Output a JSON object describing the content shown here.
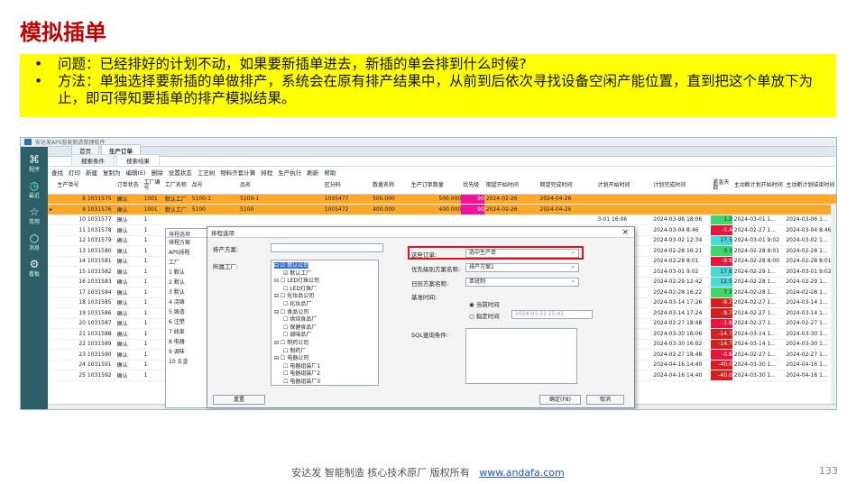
{
  "slide": {
    "title": "模拟插单",
    "bullets": [
      "问题：已经排好的计划不动，如果要新插单进去，新插的单会排到什么时候?",
      "方法：单独选择要新插的单做排产，系统会在原有排产结果中，从前到后依次寻找设备空闲产能位置，直到把这个单放下为止，即可得知要插单的排产模拟结果。"
    ],
    "bullet_symbol": "•",
    "footer_text": "安达发  智能制造 核心技术原厂  版权所有",
    "footer_link": "www.andafa.com",
    "page_number": "133"
  },
  "app": {
    "window_title": "安达发APS智能制造管理软件",
    "side": [
      {
        "icon": "⌘",
        "label": "程序"
      },
      {
        "icon": "◷",
        "label": "最近"
      },
      {
        "icon": "☆",
        "label": "常用"
      },
      {
        "icon": "○",
        "label": "消息"
      },
      {
        "icon": "⚙",
        "label": "看板"
      }
    ],
    "tabs": [
      "首页",
      "生产订单"
    ],
    "subtabs": [
      "搜索条件",
      "搜索结果"
    ],
    "toolbar": [
      "查找",
      "打印",
      "新建",
      "复制为",
      "编辑(E)",
      "删除",
      "设置状态",
      "工艺树",
      "物料齐套计算",
      "排程",
      "生产执行",
      "刷新",
      "帮助"
    ],
    "columns": [
      "生产单号",
      "订单状态",
      "工厂编号",
      "工厂名称",
      "品号",
      "品名",
      "区分码",
      "数量名称",
      "生产订单数量",
      "优先级",
      "期望开始时间",
      "期望完成时间",
      "计划开始时间",
      "计划完成时间",
      "紧急天数",
      "主动断计划开始时间",
      "主动断计划结束时间"
    ],
    "rows": [
      {
        "no": "8",
        "id": "1031575",
        "st": "确认",
        "f": "1001",
        "fn": "默认工厂",
        "pn": "5100-1",
        "pname": "5100-1",
        "q": "1005477",
        "qty": "500.000",
        "pr": "90",
        "es": "2024-02-26",
        "ee": "2024-04-26",
        "ps": "",
        "pe": "",
        "d": "",
        "as": "",
        "ae": ""
      },
      {
        "no": "9",
        "id": "1031576",
        "st": "确认",
        "f": "1001",
        "fn": "默认工厂",
        "pn": "5100",
        "pname": "5100",
        "q": "1005472",
        "qty": "400.000",
        "pr": "90",
        "es": "2024-02-26",
        "ee": "2024-04-26",
        "ps": "",
        "pe": "",
        "d": "",
        "as": "",
        "ae": ""
      },
      {
        "no": "10",
        "id": "1031577",
        "st": "确认",
        "f": "1",
        "fn": "",
        "pn": "",
        "pname": "",
        "q": "",
        "qty": "",
        "pr": "",
        "es": "",
        "ee": "",
        "ps": "3-01 16:06",
        "pe": "2024-03-06 18:06",
        "d": "1.2",
        "as": "2024-03-01 1...",
        "ae": "2024-03-06 1..."
      },
      {
        "no": "11",
        "id": "1031578",
        "st": "确认",
        "f": "1",
        "fn": "",
        "pn": "",
        "pname": "",
        "q": "",
        "qty": "",
        "pr": "",
        "es": "",
        "ee": "",
        "ps": "2-27 18:46",
        "pe": "2024-03-04 8:46",
        "d": "-5.4",
        "as": "2024-02-27 1...",
        "ae": "2024-03-04 8:46"
      },
      {
        "no": "12",
        "id": "1031579",
        "st": "确认",
        "f": "1",
        "fn": "",
        "pn": "",
        "pname": "",
        "q": "",
        "qty": "",
        "pr": "",
        "es": "",
        "ee": "",
        "ps": "3-01 9:02",
        "pe": "2024-03-02 12:34",
        "d": "17.5",
        "as": "2024-03-01 9:02",
        "ae": "2024-03-02 1..."
      },
      {
        "no": "13",
        "id": "1031580",
        "st": "确认",
        "f": "1",
        "fn": "",
        "pn": "",
        "pname": "",
        "q": "",
        "qty": "",
        "pr": "",
        "es": "",
        "ee": "",
        "ps": "2-28 8:01",
        "pe": "2024-02-28 16:21",
        "d": "3.3",
        "as": "2024-02-28 8:01",
        "ae": "2024-02-28 1..."
      },
      {
        "no": "14",
        "id": "1031581",
        "st": "确认",
        "f": "1",
        "fn": "",
        "pn": "",
        "pname": "",
        "q": "",
        "qty": "",
        "pr": "",
        "es": "",
        "ee": "",
        "ps": "2-28 8:00",
        "pe": "2024-02-28 8:01",
        "d": "-8.9",
        "as": "2024-02-28 8:00",
        "ae": "2024-02-28 8:01"
      },
      {
        "no": "15",
        "id": "1031582",
        "st": "确认",
        "f": "1",
        "fn": "",
        "pn": "",
        "pname": "",
        "q": "",
        "qty": "",
        "pr": "",
        "es": "",
        "ee": "",
        "ps": "2-29 12:42",
        "pe": "2024-03-01 9:02",
        "d": "17.6",
        "as": "2024-02-29 1...",
        "ae": "2024-03-01 9:02"
      },
      {
        "no": "16",
        "id": "1031583",
        "st": "确认",
        "f": "1",
        "fn": "",
        "pn": "",
        "pname": "",
        "q": "",
        "qty": "",
        "pr": "",
        "es": "",
        "ee": "",
        "ps": "2-28 16:22",
        "pe": "2024-02-29 12:42",
        "d": "12.5",
        "as": "2024-02-28 1...",
        "ae": "2024-02-29 1..."
      },
      {
        "no": "17",
        "id": "1031584",
        "st": "确认",
        "f": "1",
        "fn": "",
        "pn": "",
        "pname": "",
        "q": "",
        "qty": "",
        "pr": "",
        "es": "",
        "ee": "",
        "ps": "2-28 16:21",
        "pe": "2024-02-28 16:22",
        "d": "7.3",
        "as": "2024-02-28 1...",
        "ae": "2024-02-28 1..."
      },
      {
        "no": "18",
        "id": "1031585",
        "st": "确认",
        "f": "1",
        "fn": "",
        "pn": "",
        "pname": "",
        "q": "",
        "qty": "",
        "pr": "",
        "es": "",
        "ee": "",
        "ps": "2-27 18:46",
        "pe": "2024-03-14 17:26",
        "d": "-9.7",
        "as": "2024-02-27 1...",
        "ae": "2024-03-14 1..."
      },
      {
        "no": "19",
        "id": "1031586",
        "st": "确认",
        "f": "1",
        "fn": "",
        "pn": "",
        "pname": "",
        "q": "",
        "qty": "",
        "pr": "",
        "es": "",
        "ee": "",
        "ps": "2-27 18:46",
        "pe": "2024-03-14 17:24",
        "d": "-9.7",
        "as": "2024-02-27 1...",
        "ae": "2024-03-14 1..."
      },
      {
        "no": "20",
        "id": "1031587",
        "st": "确认",
        "f": "1",
        "fn": "",
        "pn": "",
        "pname": "",
        "q": "",
        "qty": "",
        "pr": "",
        "es": "",
        "ee": "",
        "ps": "2-27 18:46",
        "pe": "2024-02-27 18:48",
        "d": "-1.8",
        "as": "2024-02-27 1...",
        "ae": "2024-02-27 1..."
      },
      {
        "no": "21",
        "id": "1031588",
        "st": "确认",
        "f": "1",
        "fn": "",
        "pn": "",
        "pname": "",
        "q": "",
        "qty": "",
        "pr": "",
        "es": "",
        "ee": "",
        "ps": "3-14 17:26",
        "pe": "2024-03-30 16:06",
        "d": "-14.7",
        "as": "2024-03-14 1...",
        "ae": "2024-03-30 1..."
      },
      {
        "no": "22",
        "id": "1031589",
        "st": "确认",
        "f": "1",
        "fn": "",
        "pn": "",
        "pname": "",
        "q": "",
        "qty": "",
        "pr": "",
        "es": "",
        "ee": "",
        "ps": "3-14 17:24",
        "pe": "2024-03-30 16:02",
        "d": "-14.7",
        "as": "2024-03-14 1...",
        "ae": "2024-03-30 1..."
      },
      {
        "no": "23",
        "id": "1031590",
        "st": "确认",
        "f": "1",
        "fn": "",
        "pn": "",
        "pname": "",
        "q": "",
        "qty": "",
        "pr": "",
        "es": "",
        "ee": "",
        "ps": "2-27 18:46",
        "pe": "2024-02-27 18:48",
        "d": "-0.8",
        "as": "2024-02-27 1...",
        "ae": "2024-02-27 1..."
      },
      {
        "no": "24",
        "id": "1031591",
        "st": "确认",
        "f": "1",
        "fn": "",
        "pn": "",
        "pname": "",
        "q": "",
        "qty": "",
        "pr": "",
        "es": "",
        "ee": "",
        "ps": "3-30 16:06",
        "pe": "2024-04-16 14:40",
        "d": "-40.0",
        "as": "2024-03-30 1...",
        "ae": "2024-04-16 1..."
      },
      {
        "no": "25",
        "id": "1031592",
        "st": "确认",
        "f": "1",
        "fn": "",
        "pn": "",
        "pname": "",
        "q": "",
        "qty": "",
        "pr": "",
        "es": "",
        "ee": "",
        "ps": "3-30 16:02",
        "pe": "2024-04-16 14:40",
        "d": "-40.0",
        "as": "2024-03-30 1...",
        "ae": "2024-04-16 1..."
      }
    ],
    "panel": {
      "title": "排程选项",
      "rows": [
        "排程方案",
        "APS排程",
        "工厂",
        "1 默认",
        "2 默认",
        "3 默认",
        "4 浇铸",
        "5 铸造",
        "6 注塑",
        "7 线束",
        "8 电器",
        "9 调味",
        "10 五金"
      ]
    },
    "dialog": {
      "title": "排程选项",
      "plan_label": "排产方案:",
      "plan_value": "",
      "factory_label": "所属工厂:",
      "tree": [
        {
          "t": "⊟ ☑ 默认公司",
          "lvl": 0,
          "hl": true
        },
        {
          "t": "☑ 默认工厂",
          "lvl": 2,
          "hl": false
        },
        {
          "t": "⊟ ☐ LED灯珠公司",
          "lvl": 0,
          "hl": false
        },
        {
          "t": "☐ LED灯珠厂",
          "lvl": 2,
          "hl": false
        },
        {
          "t": "⊟ ☐ 化妆品公司",
          "lvl": 0,
          "hl": false
        },
        {
          "t": "☐ 化妆品厂",
          "lvl": 2,
          "hl": false
        },
        {
          "t": "⊟ ☐ 食品公司",
          "lvl": 0,
          "hl": false
        },
        {
          "t": "☐ 烘焙食品厂",
          "lvl": 2,
          "hl": false
        },
        {
          "t": "☐ 保健食品厂",
          "lvl": 2,
          "hl": false
        },
        {
          "t": "☐ 调味品厂",
          "lvl": 2,
          "hl": false
        },
        {
          "t": "⊟ ☐ 制药公司",
          "lvl": 0,
          "hl": false
        },
        {
          "t": "☐ 制药厂",
          "lvl": 2,
          "hl": false
        },
        {
          "t": "⊟ ☐ 电器公司",
          "lvl": 0,
          "hl": false
        },
        {
          "t": "☐ 电器组装厂1",
          "lvl": 2,
          "hl": false
        },
        {
          "t": "☐ 电器组装厂2",
          "lvl": 2,
          "hl": false
        },
        {
          "t": "☐ 电器组装厂3",
          "lvl": 2,
          "hl": false
        }
      ],
      "order_label": "这些订单:",
      "order_value": "选中生产单",
      "priority_label": "优先级别方案名称:",
      "priority_value": "排产方案1",
      "calendar_label": "日历方案名称:",
      "calendar_value": "单班制",
      "base_label": "基准时间:",
      "radio1": "当前时间",
      "radio2": "指定时间",
      "date_value": "2024-03-11 15:41",
      "sql_label": "SQL查询条件:",
      "reset_label": "重置",
      "ok_label": "确定(F8)",
      "cancel_label": "取消"
    }
  },
  "colors": {
    "title": "#c00000",
    "highlight": "#ffff00",
    "row_selected": "#ffa829",
    "box_red": "#e0141e"
  }
}
